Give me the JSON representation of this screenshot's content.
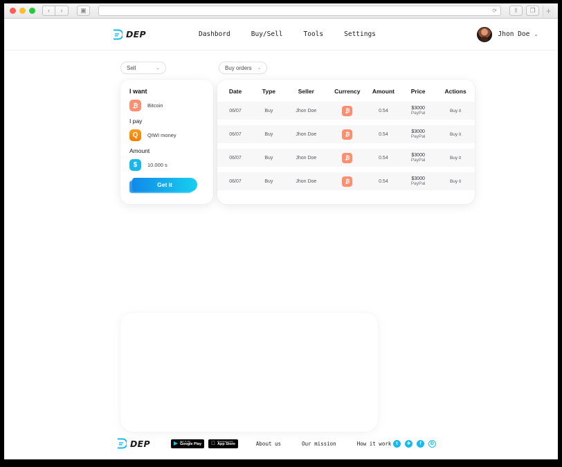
{
  "browser": {
    "back_icon": "chevron-left-icon",
    "forward_icon": "chevron-right-icon",
    "sidebar_icon": "sidebar-icon",
    "reload_icon": "reload-icon",
    "share_icon": "share-icon",
    "tabs_icon": "tabs-icon",
    "new_tab_label": "+",
    "address_value": ""
  },
  "header": {
    "logo_text": "DEP",
    "nav": [
      {
        "label": "Dashbord"
      },
      {
        "label": "Buy/Sell"
      },
      {
        "label": "Tools"
      },
      {
        "label": "Settings"
      }
    ],
    "user_name": "Jhon Doe",
    "user_chevron": "⌄"
  },
  "controls": {
    "side_select": {
      "value": "Sell",
      "chevron": "⌄"
    },
    "orders_select": {
      "value": "Buy orders",
      "chevron": "⌄"
    }
  },
  "offer_card": {
    "want_label": "I want",
    "want_value": "Bitcoin",
    "want_icon_glyph": "₿",
    "pay_label": "I pay",
    "pay_value": "QIWI money",
    "pay_icon_glyph": "Q",
    "amount_label": "Amount",
    "amount_value": "10.000 s",
    "amount_icon_glyph": "$",
    "submit_label": "Get it"
  },
  "orders_table": {
    "columns": [
      "Date",
      "Type",
      "Seller",
      "Currency",
      "Amount",
      "Price",
      "Actions"
    ],
    "rows": [
      {
        "date": "06/07",
        "type": "Buy",
        "seller": "Jhon Doe",
        "currency": "₿",
        "amount": "0.54",
        "price": "$3000",
        "price_method": "PayPal",
        "action": "Buy it"
      },
      {
        "date": "06/07",
        "type": "Buy",
        "seller": "Jhon Doe",
        "currency": "₿",
        "amount": "0.54",
        "price": "$3000",
        "price_method": "PayPal",
        "action": "Buy it"
      },
      {
        "date": "06/07",
        "type": "Buy",
        "seller": "Jhon Doe",
        "currency": "₿",
        "amount": "0.54",
        "price": "$3000",
        "price_method": "PayPal",
        "action": "Buy it"
      },
      {
        "date": "06/07",
        "type": "Buy",
        "seller": "Jhon Doe",
        "currency": "₿",
        "amount": "0.54",
        "price": "$3000",
        "price_method": "PayPal",
        "action": "Buy it"
      }
    ]
  },
  "footer": {
    "logo_text": "DEP",
    "google_play": {
      "small": "GET IT ON",
      "big": "Google Play"
    },
    "app_store": {
      "small": "Download on the",
      "big": "App Store",
      "glyph": ""
    },
    "links": [
      {
        "label": "About us"
      },
      {
        "label": "Our mission"
      },
      {
        "label": "How it work"
      }
    ],
    "socials": [
      {
        "name": "twitter-icon",
        "glyph": "t"
      },
      {
        "name": "telegram-icon",
        "glyph": "✈"
      },
      {
        "name": "facebook-icon",
        "glyph": "f"
      },
      {
        "name": "dep-circle-icon",
        "glyph": "Ɖ"
      }
    ]
  },
  "colors": {
    "accent_cyan": "#17b9ef",
    "accent_blue": "#1189e9",
    "bitcoin": "#fb8f72",
    "qiwi": "#ff8c00",
    "usd": "#18b8ec"
  }
}
